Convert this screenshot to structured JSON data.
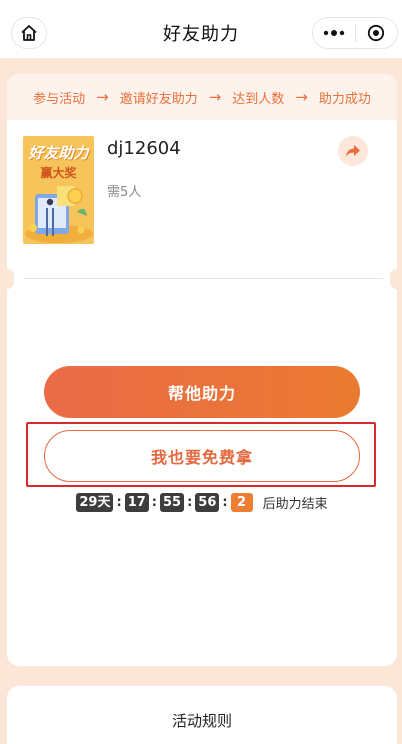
{
  "nav": {
    "title": "好友助力",
    "home_icon": "home-icon",
    "more_icon": "more-dots-icon",
    "close_icon": "target-close-icon"
  },
  "steps": [
    {
      "label": "参与活动"
    },
    {
      "label": "邀请好友助力"
    },
    {
      "label": "达到人数"
    },
    {
      "label": "助力成功"
    }
  ],
  "step_arrow": "→",
  "poster": {
    "line1": "好友助力",
    "line2": "赢大奖"
  },
  "activity": {
    "username": "dj12604",
    "need_text": "需5人"
  },
  "buttons": {
    "help_label": "帮他助力",
    "free_label": "我也要免费拿"
  },
  "countdown": {
    "days": "29天",
    "hours": "17",
    "minutes": "55",
    "seconds": "56",
    "tenths": "2",
    "suffix": "后助力结束"
  },
  "rules": {
    "title": "活动规则"
  },
  "colors": {
    "accent": "#e8703a",
    "background": "#fbe6d8",
    "highlight_border": "#d62b2b"
  }
}
